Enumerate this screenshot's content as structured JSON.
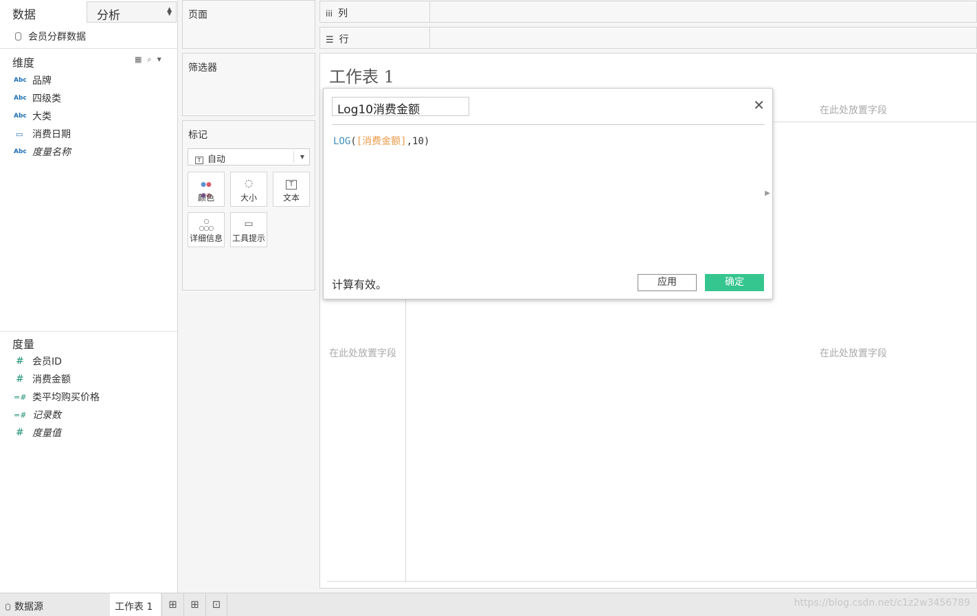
{
  "left_pane": {
    "tab_data": "数据",
    "tab_analysis": "分析",
    "datasource": "会员分群数据",
    "dimensions_title": "维度",
    "dimensions": [
      {
        "icon": "Abc",
        "label": "品牌",
        "italic": false
      },
      {
        "icon": "Abc",
        "label": "四级类",
        "italic": false
      },
      {
        "icon": "Abc",
        "label": "大类",
        "italic": false
      },
      {
        "icon": "calendar",
        "label": "消费日期",
        "italic": false
      },
      {
        "icon": "Abc",
        "label": "度量名称",
        "italic": true
      }
    ],
    "measures_title": "度量",
    "measures": [
      {
        "icon": "#",
        "label": "会员ID",
        "italic": false
      },
      {
        "icon": "#",
        "label": "消费金额",
        "italic": false
      },
      {
        "icon": "=#",
        "label": "类平均购买价格",
        "italic": false
      },
      {
        "icon": "=#",
        "label": "记录数",
        "italic": true
      },
      {
        "icon": "#",
        "label": "度量值",
        "italic": true
      }
    ]
  },
  "shelves": {
    "pages": "页面",
    "filters": "筛选器",
    "marks": "标记",
    "marks_type": "自动",
    "mark_buttons": [
      "颜色",
      "大小",
      "文本",
      "详细信息",
      "工具提示"
    ],
    "columns": "列",
    "rows": "行"
  },
  "view": {
    "sheet_title": "工作表 1",
    "drop_field_top": "在此处放置字段",
    "drop_field_left": "在此处放置字段",
    "drop_field_right": "在此处放置字段"
  },
  "calc_dialog": {
    "name": "Log10消费金额",
    "formula_fn": "LOG",
    "formula_open": "(",
    "formula_field": "[消费金额]",
    "formula_rest": ",10)",
    "status": "计算有效。",
    "apply": "应用",
    "ok": "确定"
  },
  "bottom_bar": {
    "datasource": "数据源",
    "sheet": "工作表 1",
    "watermark": "https://blog.csdn.net/c1z2w3456789"
  },
  "colors": {
    "ok_button": "#35c58f",
    "formula_function": "#3d8eb9",
    "formula_field": "#ea9a48",
    "measure_icon": "#1d8f77",
    "dimension_icon": "#1f6fb3"
  }
}
